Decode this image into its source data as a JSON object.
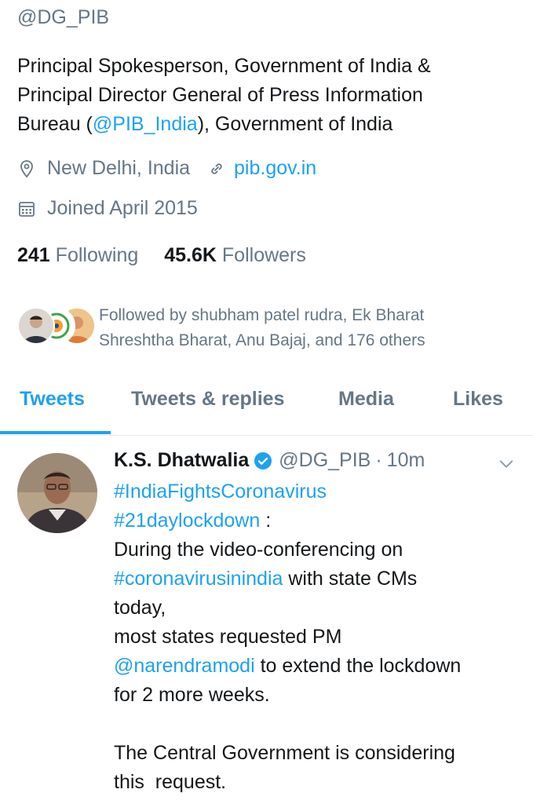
{
  "profile": {
    "handle": "@DG_PIB",
    "bio": {
      "line1": "Principal Spokesperson, Government of India &",
      "line2": "Principal Director General of Press Information",
      "line3_pre": "Bureau (",
      "line3_link": "@PIB_India",
      "line3_post": "), Government of India"
    },
    "location": "New Delhi, India",
    "website": "pib.gov.in",
    "joined": "Joined April 2015",
    "following_count": "241",
    "following_label": "Following",
    "followers_count": "45.6K",
    "followers_label": "Followers",
    "followed_by": {
      "line1": "Followed by shubham patel rudra, Ek Bharat",
      "line2": "Shreshtha Bharat, Anu Bajaj, and 176 others"
    }
  },
  "tabs": [
    {
      "label": "Tweets",
      "active": true
    },
    {
      "label": "Tweets & replies",
      "active": false
    },
    {
      "label": "Media",
      "active": false
    },
    {
      "label": "Likes",
      "active": false
    }
  ],
  "tweet": {
    "author_name": "K.S. Dhatwalia",
    "author_handle": "@DG_PIB",
    "separator": "·",
    "time": "10m",
    "hashtag1": "#IndiaFightsCoronavirus",
    "hashtag2": "#21daylockdown",
    "hashtag2_suffix": " :",
    "line3": "During the video-conferencing on",
    "hashtag3": "#coronavirusinindia",
    "hashtag3_suffix": " with state CMs",
    "line5": "today,",
    "line6": "most states requested PM",
    "mention": "@narendramodi",
    "mention_suffix": " to extend the lockdown",
    "line8": "for 2 more weeks.",
    "line9": "The Central Government is considering",
    "line10": "this  request."
  },
  "colors": {
    "accent": "#1da1f2",
    "secondary_text": "#657786",
    "primary_text": "#14171a",
    "divider": "#e1e8ed"
  },
  "icons": [
    "location-pin-icon",
    "link-icon",
    "calendar-icon",
    "verified-badge-icon",
    "chevron-down-icon"
  ]
}
